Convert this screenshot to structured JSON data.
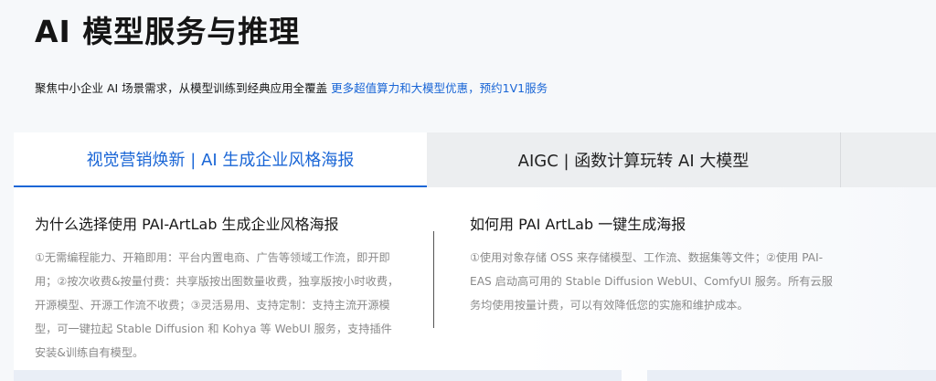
{
  "header": {
    "title": "AI 模型服务与推理",
    "subtitle_text": "聚焦中小企业 AI 场景需求，从模型训练到经典应用全覆盖 ",
    "subtitle_link": "更多超值算力和大模型优惠，预约1V1服务"
  },
  "tabs": [
    {
      "label": "视觉营销焕新 | AI 生成企业风格海报",
      "active": true
    },
    {
      "label": "AIGC | 函数计算玩转 AI 大模型",
      "active": false
    }
  ],
  "panel": {
    "left": {
      "heading": "为什么选择使用 PAI-ArtLab 生成企业风格海报",
      "body": "①无需编程能力、开箱即用：平台内置电商、广告等领域工作流，即开即用；②按次收费&按量付费：共享版按出图数量收费，独享版按小时收费，开源模型、开源工作流不收费；③灵活易用、支持定制：支持主流开源模型，可一键拉起 Stable Diffusion 和 Kohya 等 WebUI 服务，支持插件安装&训练自有模型。"
    },
    "right": {
      "heading": "如何用 PAI ArtLab 一键生成海报",
      "body": "①使用对象存储 OSS 来存储模型、工作流、数据集等文件；②使用 PAI-EAS 启动高可用的 Stable Diffusion WebUI、ComfyUI 服务。所有云服务均使用按量计费，可以有效降低您的实施和维护成本。"
    }
  },
  "colors": {
    "accent": "#1a66d6",
    "muted_text": "#8a8a8a",
    "inactive_tab_bg": "#eceef0"
  }
}
